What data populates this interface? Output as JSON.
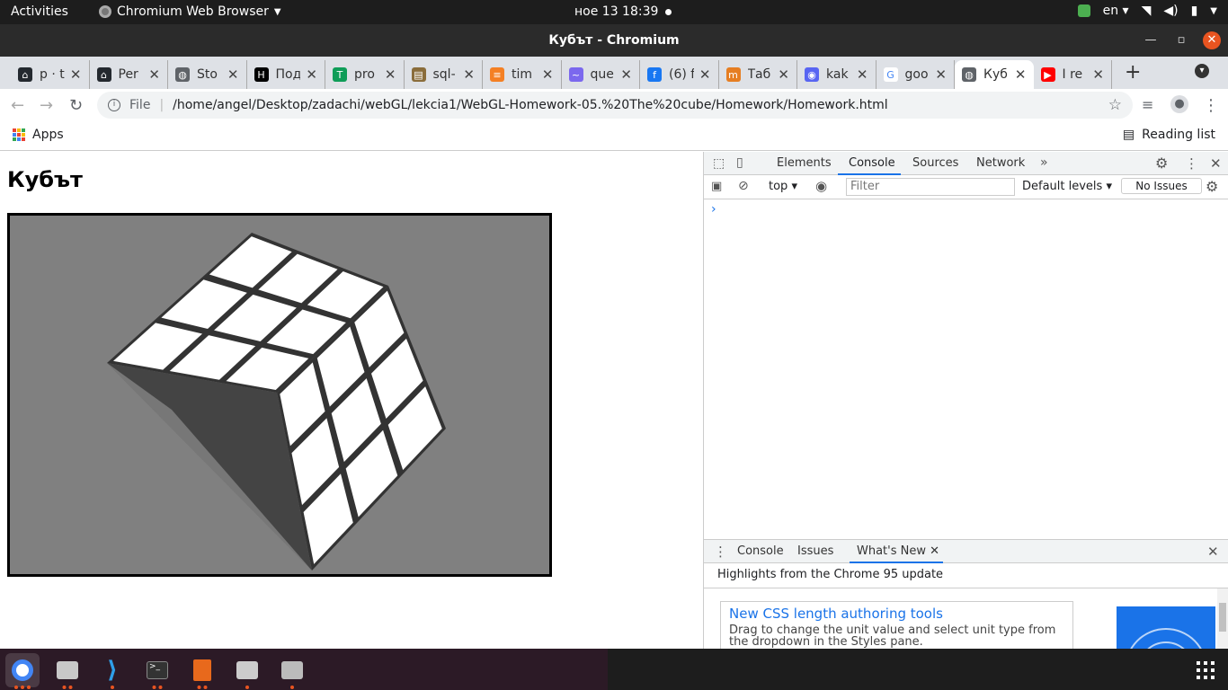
{
  "topbar": {
    "activities": "Activities",
    "app_name": "Chromium Web Browser",
    "clock": "ное 13  18:39",
    "lang": "en"
  },
  "window": {
    "title": "Кубът - Chromium"
  },
  "tabs": [
    {
      "label": "p · t",
      "fav_color": "#24292f",
      "fav_text": "⌂"
    },
    {
      "label": "Per",
      "fav_color": "#24292f",
      "fav_text": "⌂"
    },
    {
      "label": "Sto",
      "fav_color": "#5f6368",
      "fav_text": "◍"
    },
    {
      "label": "Под",
      "fav_color": "#000000",
      "fav_text": "H"
    },
    {
      "label": "pro",
      "fav_color": "#0f9d58",
      "fav_text": "T"
    },
    {
      "label": "sql-",
      "fav_color": "#8a6d3b",
      "fav_text": "▤"
    },
    {
      "label": "tim",
      "fav_color": "#f48024",
      "fav_text": "≡"
    },
    {
      "label": "que",
      "fav_color": "#7b68ee",
      "fav_text": "~"
    },
    {
      "label": "(6) f",
      "fav_color": "#1877f2",
      "fav_text": "f"
    },
    {
      "label": "Таб",
      "fav_color": "#e67e22",
      "fav_text": "m"
    },
    {
      "label": "kak",
      "fav_color": "#5865f2",
      "fav_text": "◉"
    },
    {
      "label": "goo",
      "fav_color": "#ffffff",
      "fav_text": "G"
    },
    {
      "label": "Куб",
      "fav_color": "#5f6368",
      "fav_text": "◍"
    },
    {
      "label": "I re",
      "fav_color": "#ff0000",
      "fav_text": "▶"
    }
  ],
  "toolbar": {
    "file_label": "File",
    "url": "/home/angel/Desktop/zadachi/webGL/lekcia1/WebGL-Homework-05.%20The%20cube/Homework/Homework.html"
  },
  "bookmarks": {
    "apps": "Apps",
    "reading_list": "Reading list"
  },
  "page": {
    "heading": "Кубът"
  },
  "devtools": {
    "tabs": [
      "Elements",
      "Console",
      "Sources",
      "Network"
    ],
    "context": "top",
    "filter_placeholder": "Filter",
    "levels": "Default levels",
    "no_issues": "No Issues",
    "prompt": "›",
    "drawer_tabs": [
      "Console",
      "Issues",
      "What's New"
    ],
    "highlights": "Highlights from the Chrome 95 update",
    "card_title": "New CSS length authoring tools",
    "card_desc": "Drag to change the unit value and select unit type from the dropdown in the Styles pane."
  },
  "colors": {
    "accent": "#1a73e8",
    "ubuntu_orange": "#e95420",
    "canvas_bg": "#808080"
  }
}
